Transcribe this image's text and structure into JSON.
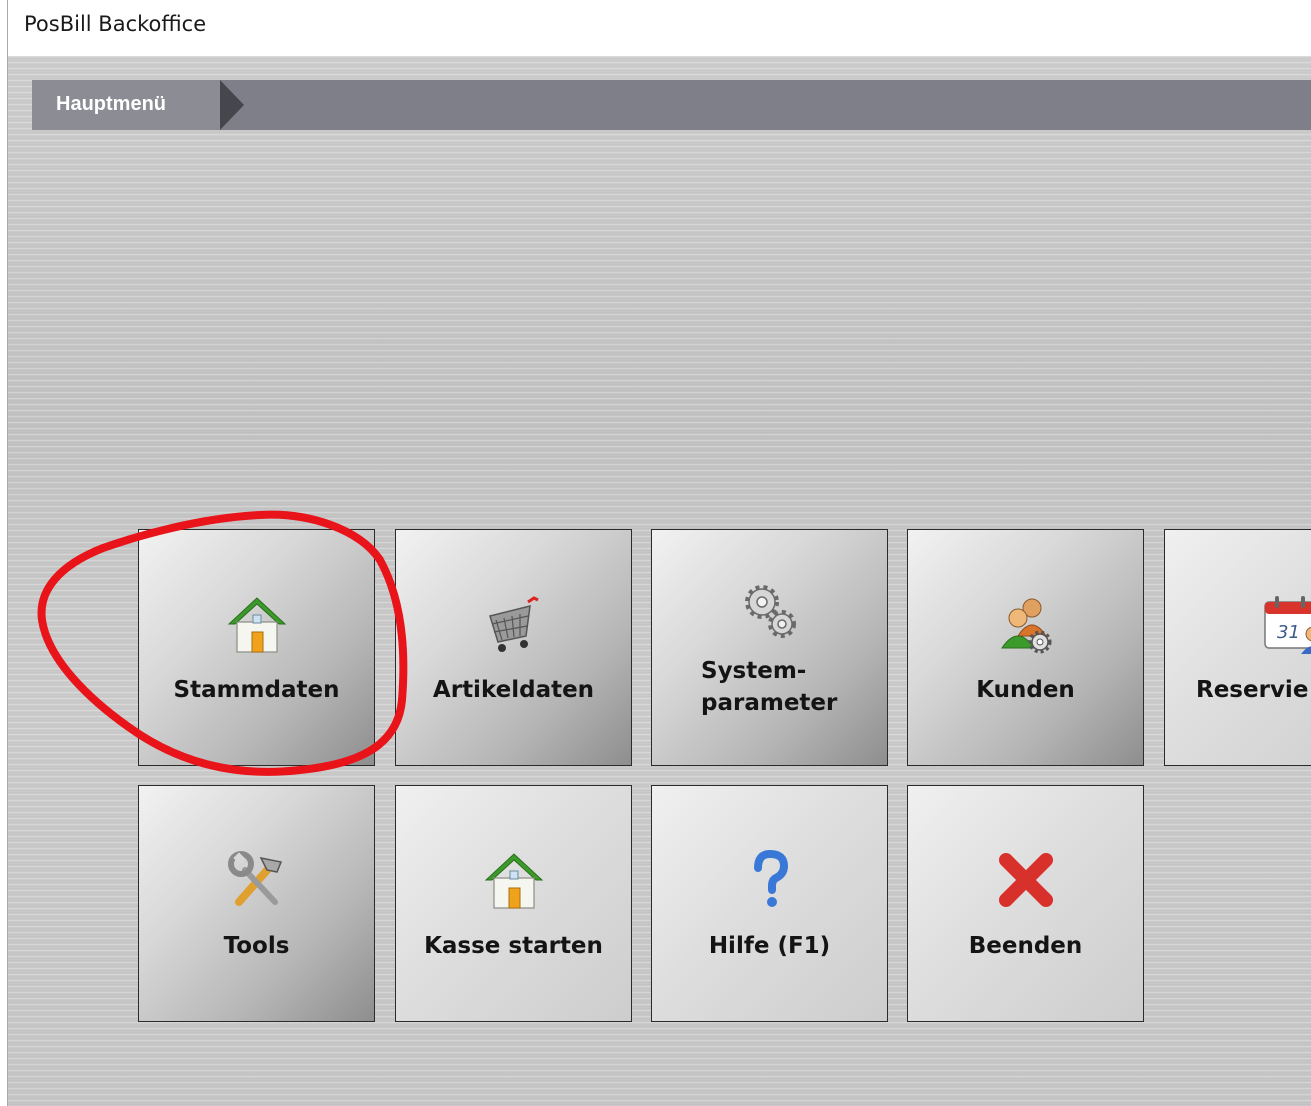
{
  "window": {
    "title": "PosBill Backoffice"
  },
  "breadcrumb": {
    "items": [
      {
        "label": "Hauptmenü"
      }
    ]
  },
  "menu": {
    "tiles": [
      {
        "label": "Stammdaten",
        "icon": "house-icon",
        "shade": "dark",
        "annotated": true
      },
      {
        "label": "Artikeldaten",
        "icon": "shopping-cart-icon",
        "shade": "dark"
      },
      {
        "label": "System-\nparameter",
        "icon": "gears-icon",
        "shade": "dark"
      },
      {
        "label": "Kunden",
        "icon": "users-gear-icon",
        "shade": "dark"
      },
      {
        "label": "Reservie",
        "icon": "calendar-user-icon",
        "shade": "light"
      },
      {
        "label": "Tools",
        "icon": "tools-icon",
        "shade": "dark"
      },
      {
        "label": "Kasse starten",
        "icon": "house-icon",
        "shade": "light"
      },
      {
        "label": "Hilfe (F1)",
        "icon": "question-mark-icon",
        "shade": "light"
      },
      {
        "label": "Beenden",
        "icon": "close-x-icon",
        "shade": "light"
      }
    ]
  },
  "calendar_icon_text": "31",
  "colors": {
    "annotation": "#e8141a",
    "breadcrumb_bar": "#7e7f88",
    "background": "#c9c9c9"
  }
}
